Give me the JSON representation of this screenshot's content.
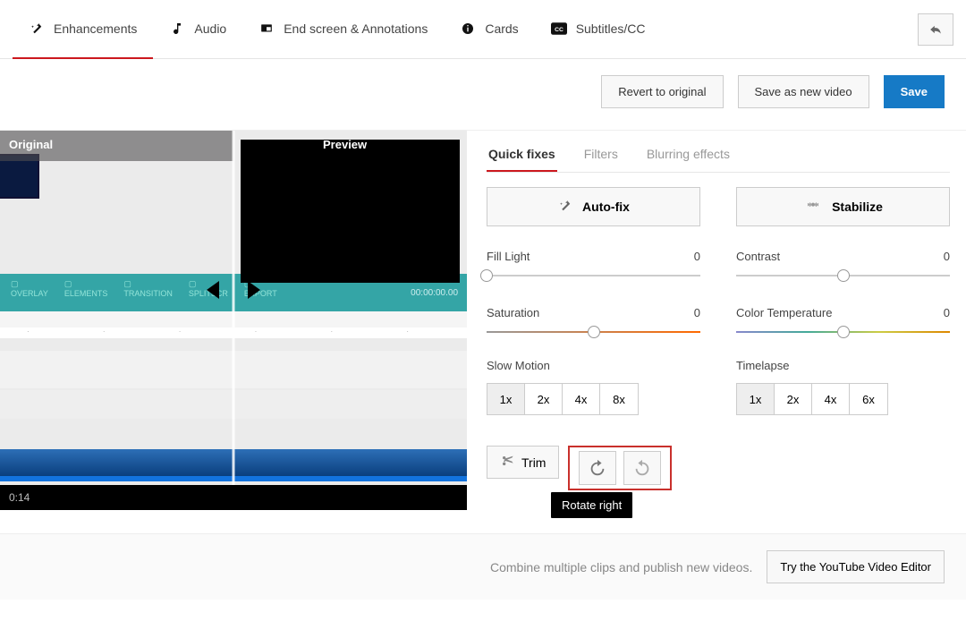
{
  "tabs": {
    "enhancements": "Enhancements",
    "audio": "Audio",
    "endscreen": "End screen & Annotations",
    "cards": "Cards",
    "subtitles": "Subtitles/CC"
  },
  "actions": {
    "revert": "Revert to original",
    "saveAsNew": "Save as new video",
    "save": "Save"
  },
  "preview": {
    "original": "Original",
    "preview": "Preview",
    "time": "0:14",
    "timecode": "00:00:00.00"
  },
  "subtabs": {
    "quick": "Quick fixes",
    "filters": "Filters",
    "blurring": "Blurring effects"
  },
  "bigButtons": {
    "autofix": "Auto-fix",
    "stabilize": "Stabilize"
  },
  "sliders": {
    "fillLight": {
      "label": "Fill Light",
      "value": "0",
      "pos": 0
    },
    "contrast": {
      "label": "Contrast",
      "value": "0",
      "pos": 50
    },
    "saturation": {
      "label": "Saturation",
      "value": "0",
      "pos": 50
    },
    "colorTemp": {
      "label": "Color Temperature",
      "value": "0",
      "pos": 50
    }
  },
  "groups": {
    "slow": {
      "label": "Slow Motion",
      "opts": [
        "1x",
        "2x",
        "4x",
        "8x"
      ],
      "active": "1x"
    },
    "time": {
      "label": "Timelapse",
      "opts": [
        "1x",
        "2x",
        "4x",
        "6x"
      ],
      "active": "1x"
    }
  },
  "trim": "Trim",
  "tooltip": "Rotate right",
  "footer": {
    "msg": "Combine multiple clips and publish new videos.",
    "btn": "Try the YouTube Video Editor"
  }
}
